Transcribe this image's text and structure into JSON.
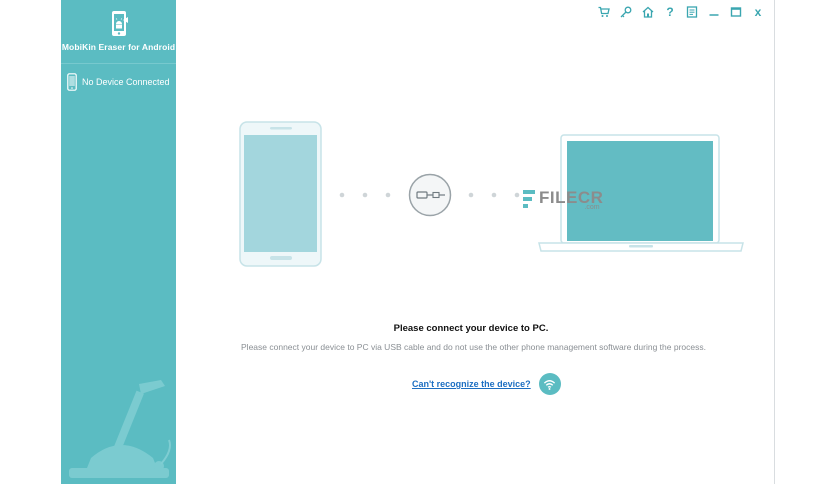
{
  "app": {
    "title": "MobiKin Eraser for Android",
    "accent_color": "#5bbcc2",
    "link_color": "#1d6fc2"
  },
  "sidebar": {
    "device_status": "No Device Connected",
    "device_icon": "phone-icon",
    "logo_icon": "android-phone-logo"
  },
  "toolbar": {
    "buttons": [
      {
        "name": "cart-icon"
      },
      {
        "name": "key-icon"
      },
      {
        "name": "home-icon"
      },
      {
        "name": "help-icon",
        "glyph": "?"
      },
      {
        "name": "feedback-icon"
      },
      {
        "name": "minimize-icon"
      },
      {
        "name": "maximize-icon"
      },
      {
        "name": "close-icon",
        "glyph": "x"
      }
    ]
  },
  "main": {
    "prompt_title": "Please connect your device to PC.",
    "prompt_description": "Please connect your device to PC via USB cable and do not use the other phone management software during the process.",
    "help_link": "Can't recognize the device?",
    "help_icon": "wifi-icon"
  },
  "watermark": {
    "text": "FILECR",
    "suffix": ".com"
  }
}
